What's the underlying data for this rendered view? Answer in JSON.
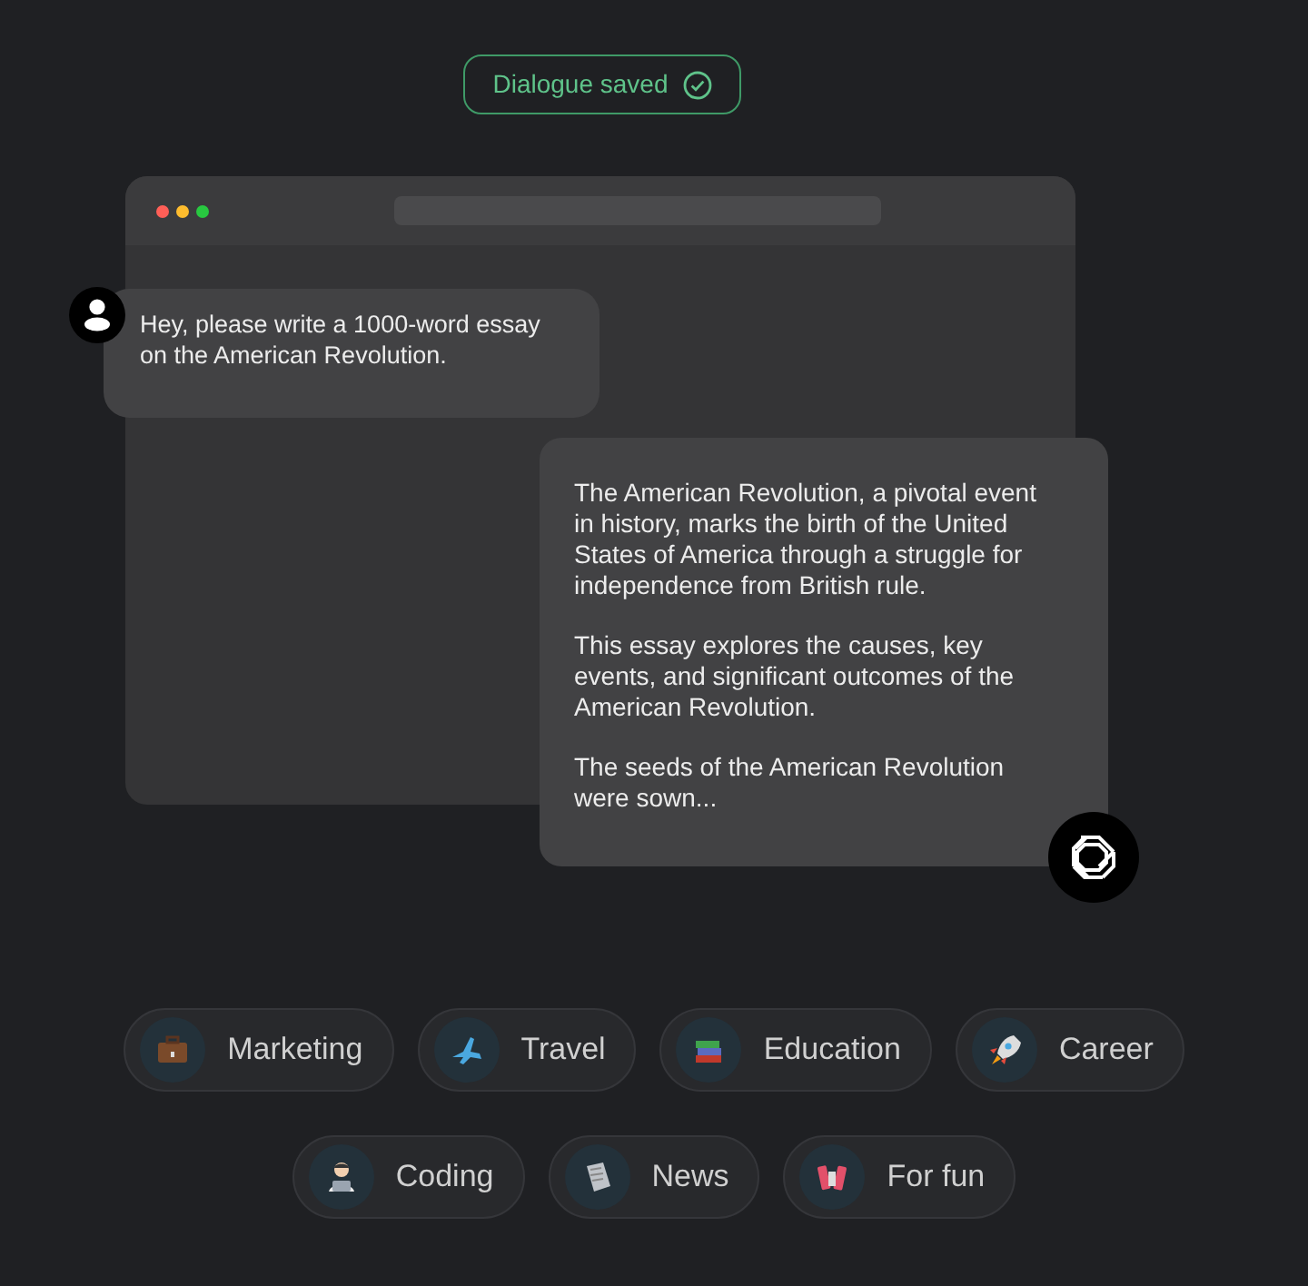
{
  "status_badge": {
    "label": "Dialogue saved"
  },
  "conversation": [
    {
      "kind": "user",
      "paragraphs": [
        "Hey, please write a 1000-word essay on the American Revolution."
      ]
    },
    {
      "kind": "assistant",
      "paragraphs": [
        "The American Revolution, a pivotal event in history, marks the birth of the United States of America through a struggle for independence from British rule.",
        "This essay explores the causes, key events, and significant outcomes of the American Revolution.",
        "The seeds of the American Revolution were sown..."
      ]
    }
  ],
  "topic_chips": [
    {
      "label": "Marketing"
    },
    {
      "label": "Travel"
    },
    {
      "label": "Education"
    },
    {
      "label": "Career"
    },
    {
      "label": "Coding"
    },
    {
      "label": "News"
    },
    {
      "label": "For fun"
    }
  ]
}
